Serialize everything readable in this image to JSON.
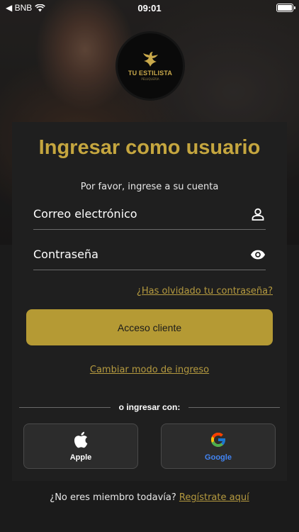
{
  "status_bar": {
    "back_label": "◀ BNB",
    "time": "09:01"
  },
  "logo": {
    "name": "TU ESTILISTA",
    "subtitle": "PELUQUERÍA"
  },
  "login": {
    "title": "Ingresar como usuario",
    "subtitle": "Por favor, ingrese a su cuenta",
    "email_label": "Correo electrónico",
    "password_label": "Contraseña",
    "forgot_link": "¿Has olvidado tu contraseña?",
    "submit_label": "Acceso cliente",
    "change_mode_link": "Cambiar modo de ingreso",
    "divider_text": "o ingresar con:",
    "apple_label": "Apple",
    "google_label": "Google"
  },
  "footer": {
    "prompt": "¿No eres miembro todavía?",
    "register_link": "Regístrate aquí"
  },
  "colors": {
    "accent": "#b59a34",
    "title": "#c5a63f",
    "card": "#1f1f1f",
    "google_label": "#4285F4"
  }
}
